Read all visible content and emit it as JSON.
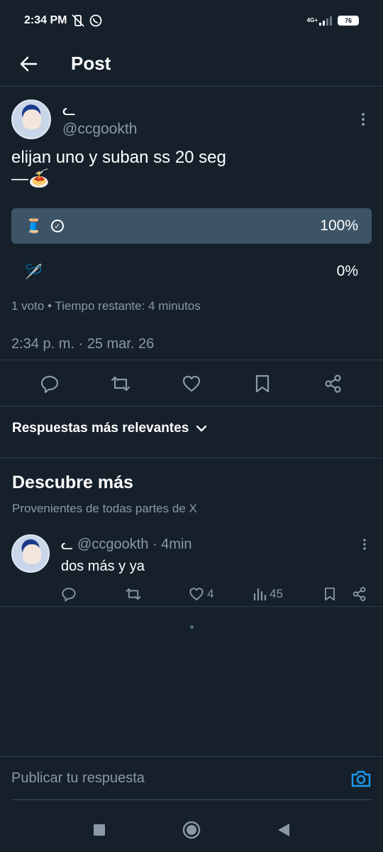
{
  "status_bar": {
    "time": "2:34 PM",
    "battery": "76",
    "network": "4G+"
  },
  "header": {
    "title": "Post"
  },
  "post": {
    "display_name": "ᓚ",
    "handle": "@ccgookth",
    "text": "elijan uno y suban ss 20 seg\n—🍝",
    "poll": {
      "options": [
        {
          "emoji": "🧵",
          "percent_label": "100%",
          "percent": 100,
          "selected": true
        },
        {
          "emoji": "🪡",
          "percent_label": "0%",
          "percent": 0,
          "selected": false
        }
      ],
      "meta": "1 voto • Tiempo restante: 4 minutos"
    },
    "timestamp": "2:34 p. m. · 25 mar. 26"
  },
  "sort": {
    "label": "Respuestas más relevantes"
  },
  "discover": {
    "title": "Descubre más",
    "subtitle": "Provenientes de todas partes de X"
  },
  "reply": {
    "display_name": "ᓚ",
    "handle_time": "@ccgookth · 4min",
    "text": "dos más y ya",
    "likes": "4",
    "views": "45"
  },
  "compose": {
    "placeholder": "Publicar tu respuesta"
  },
  "colors": {
    "background": "#15202b",
    "accent": "#1d9bf0",
    "muted": "#8b98a5",
    "poll_fill": "#3d5466"
  }
}
